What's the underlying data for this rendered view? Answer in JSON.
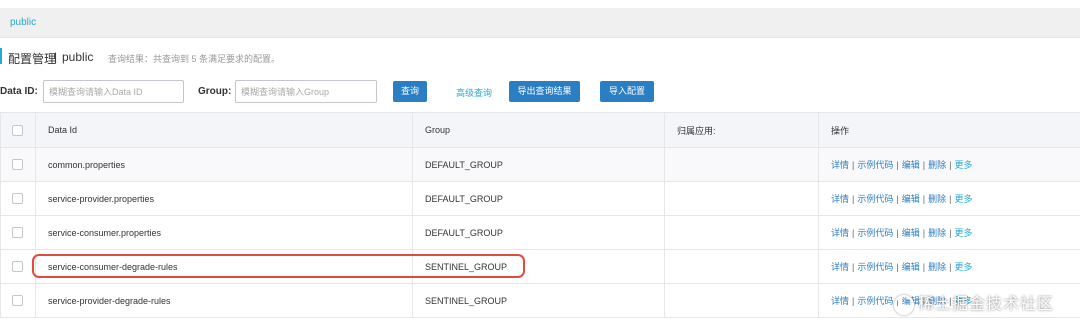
{
  "namespace_bar": {
    "active_tab": "public"
  },
  "header": {
    "title": "配置管理",
    "separator": "|",
    "namespace": "public",
    "result_text": "查询结果：共查询到 5 条满足要求的配置。"
  },
  "search": {
    "data_id_label": "Data ID:",
    "data_id_placeholder": "模糊查询请输入Data ID",
    "group_label": "Group:",
    "group_placeholder": "模糊查询请输入Group",
    "query_button": "查询",
    "advanced_query": "高级查询",
    "export_button": "导出查询结果",
    "import_button": "导入配置"
  },
  "table": {
    "columns": [
      "Data Id",
      "Group",
      "归属应用:",
      "操作"
    ],
    "rows": [
      {
        "data_id": "common.properties",
        "group": "DEFAULT_GROUP",
        "app": ""
      },
      {
        "data_id": "service-provider.properties",
        "group": "DEFAULT_GROUP",
        "app": ""
      },
      {
        "data_id": "service-consumer.properties",
        "group": "DEFAULT_GROUP",
        "app": ""
      },
      {
        "data_id": "service-consumer-degrade-rules",
        "group": "SENTINEL_GROUP",
        "app": ""
      },
      {
        "data_id": "service-provider-degrade-rules",
        "group": "SENTINEL_GROUP",
        "app": ""
      }
    ],
    "actions": {
      "detail": "详情",
      "sample_code": "示例代码",
      "edit": "编辑",
      "delete": "删除",
      "more": "更多"
    }
  },
  "watermark": "稀土掘金技术社区",
  "colors": {
    "accent": "#28a8d2",
    "button": "#2a7ec3",
    "highlight": "#e04a3f"
  }
}
